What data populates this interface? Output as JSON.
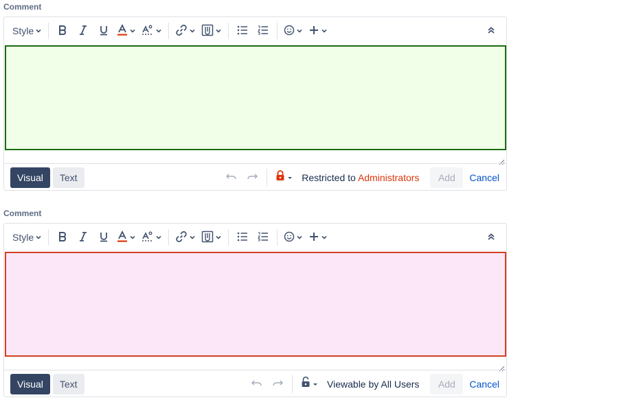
{
  "editors": [
    {
      "label": "Comment",
      "style_label": "Style",
      "mode_visual": "Visual",
      "mode_text": "Text",
      "restriction_prefix": "Restricted to",
      "restriction_group": "Administrators",
      "add_label": "Add",
      "cancel_label": "Cancel",
      "lock_state": "locked",
      "area_state": "valid"
    },
    {
      "label": "Comment",
      "style_label": "Style",
      "mode_visual": "Visual",
      "mode_text": "Text",
      "restriction_prefix": "Viewable by All Users",
      "restriction_group": "",
      "add_label": "Add",
      "cancel_label": "Cancel",
      "lock_state": "unlocked",
      "area_state": "invalid"
    }
  ],
  "colors": {
    "valid_bg": "#f1ffe8",
    "valid_border": "#1c6b13",
    "invalid_bg": "#fbe7f7",
    "invalid_border": "#d14122",
    "lock_red": "#de350b",
    "link_blue": "#0052cc"
  },
  "icons": [
    "bold-icon",
    "italic-icon",
    "underline-icon",
    "text-color-icon",
    "text-effects-icon",
    "link-icon",
    "attachment-icon",
    "bullet-list-icon",
    "numbered-list-icon",
    "emoji-icon",
    "insert-more-icon",
    "collapse-toolbar-icon",
    "undo-icon",
    "redo-icon",
    "lock-icon",
    "unlock-icon",
    "resize-handle-icon"
  ]
}
